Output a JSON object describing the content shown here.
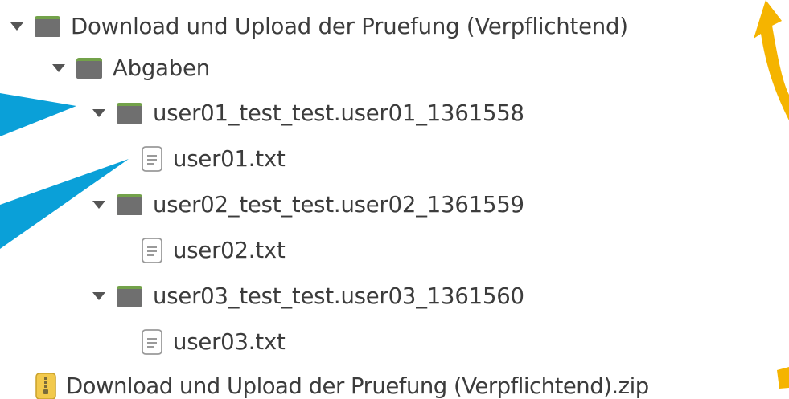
{
  "tree": {
    "items": [
      {
        "label": "Download und Upload der Pruefung (Verpflichtend)",
        "type": "folder",
        "expanded": true
      },
      {
        "label": "Abgaben",
        "type": "folder",
        "expanded": true
      },
      {
        "label": "user01_test_test.user01_1361558",
        "type": "folder",
        "expanded": true
      },
      {
        "label": "user01.txt",
        "type": "text-file"
      },
      {
        "label": "user02_test_test.user02_1361559",
        "type": "folder",
        "expanded": true
      },
      {
        "label": "user02.txt",
        "type": "text-file"
      },
      {
        "label": "user03_test_test.user03_1361560",
        "type": "folder",
        "expanded": true
      },
      {
        "label": "user03.txt",
        "type": "text-file"
      },
      {
        "label": "Download und Upload der Pruefung (Verpflichtend).zip",
        "type": "zip-archive"
      }
    ]
  },
  "icons": {
    "expander": "triangle-down-icon",
    "folder": "folder-icon",
    "text_file": "text-file-icon",
    "zip": "zip-archive-icon"
  },
  "colors": {
    "text": "#3c3c3c",
    "folder_body": "#6f6f6f",
    "folder_tab": "#73a24a",
    "annotation_blue": "#0aa0d8",
    "annotation_yellow": "#f5b400",
    "zip_body": "#f2c94c"
  }
}
